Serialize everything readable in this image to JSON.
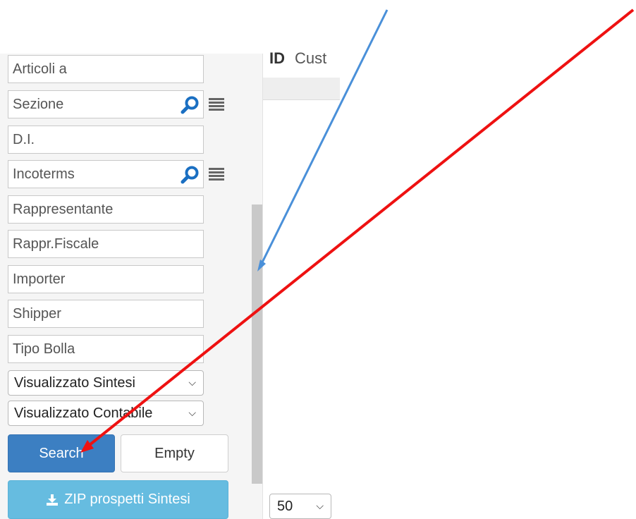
{
  "filters": {
    "articoli": {
      "placeholder": "Articoli a"
    },
    "sezione": {
      "placeholder": "Sezione",
      "lookup_icon": "search-icon",
      "list_icon": "menu-icon"
    },
    "di": {
      "placeholder": "D.I."
    },
    "incoterms": {
      "placeholder": "Incoterms",
      "lookup_icon": "search-icon",
      "list_icon": "menu-icon"
    },
    "rappresentante": {
      "placeholder": "Rappresentante"
    },
    "rappr_fiscale": {
      "placeholder": "Rappr.Fiscale"
    },
    "importer": {
      "placeholder": "Importer"
    },
    "shipper": {
      "placeholder": "Shipper"
    },
    "tipo_bolla": {
      "placeholder": "Tipo Bolla"
    },
    "visualizzato_sintesi": {
      "selected": "Visualizzato Sintesi"
    },
    "visualizzato_contabile": {
      "selected": "Visualizzato Contabile"
    }
  },
  "buttons": {
    "search": "Search",
    "empty": "Empty",
    "zip": "ZIP prospetti Sintesi"
  },
  "header": {
    "fragment_bold": "ID",
    "fragment": "Cust"
  },
  "pager": {
    "page_size": "50"
  },
  "colors": {
    "primary": "#3c7fc2",
    "info": "#66bce0",
    "lookup_icon": "#1a6fc2",
    "annotation_blue": "#4a90d9",
    "annotation_red": "#ee1111"
  }
}
